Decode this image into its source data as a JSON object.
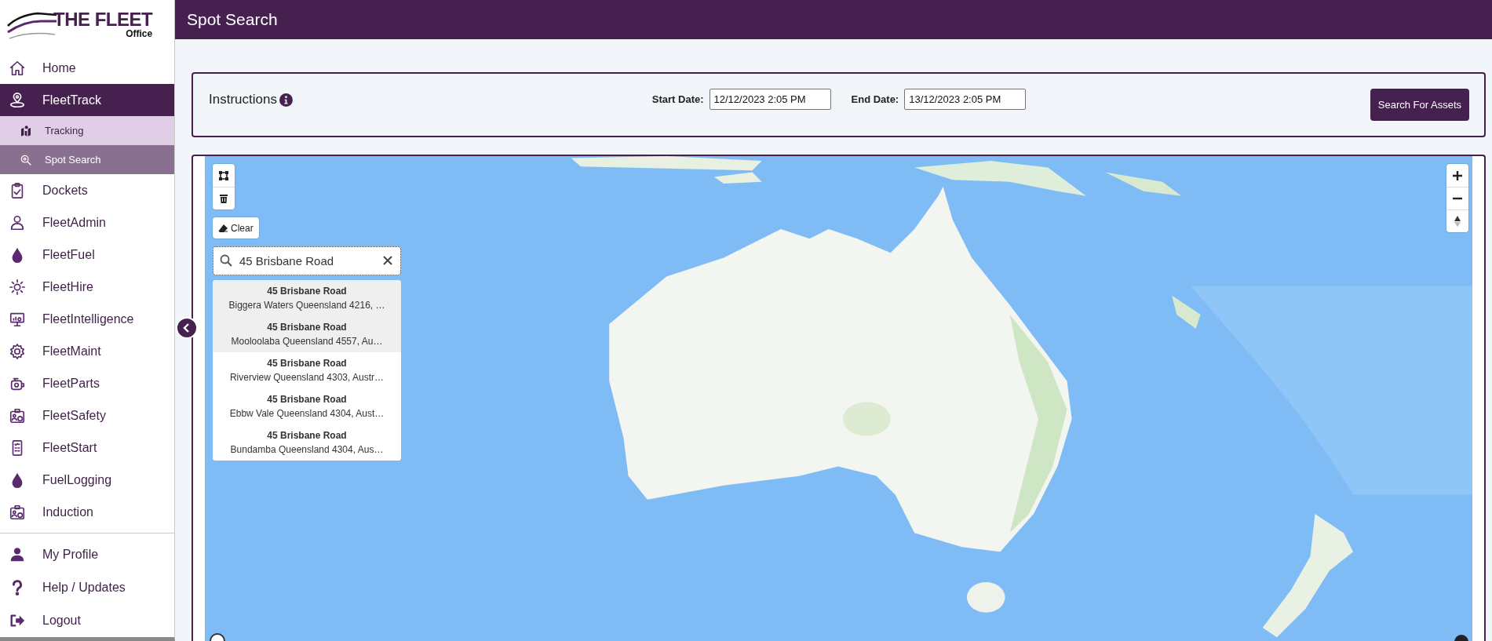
{
  "sidebar": {
    "logo": {
      "title": "THE FLEET",
      "subtitle": "Office"
    },
    "items": [
      {
        "label": "Home",
        "selected": false
      },
      {
        "label": "FleetTrack",
        "selected": true,
        "expanded": true,
        "children": [
          {
            "label": "Tracking",
            "selected": false
          },
          {
            "label": "Spot Search",
            "selected": true
          }
        ]
      },
      {
        "label": "Dockets",
        "selected": false
      },
      {
        "label": "FleetAdmin",
        "selected": false
      },
      {
        "label": "FleetFuel",
        "selected": false
      },
      {
        "label": "FleetHire",
        "selected": false
      },
      {
        "label": "FleetIntelligence",
        "selected": false
      },
      {
        "label": "FleetMaint",
        "selected": false
      },
      {
        "label": "FleetParts",
        "selected": false
      },
      {
        "label": "FleetSafety",
        "selected": false
      },
      {
        "label": "FleetStart",
        "selected": false
      },
      {
        "label": "FuelLogging",
        "selected": false
      },
      {
        "label": "Induction",
        "selected": false
      }
    ],
    "footer_items": [
      {
        "label": "My Profile"
      },
      {
        "label": "Help / Updates"
      },
      {
        "label": "Logout"
      }
    ]
  },
  "header": {
    "title": "Spot Search"
  },
  "filters": {
    "instructions": "Instructions",
    "start_date": {
      "label": "Start Date:",
      "value": "12/12/2023 2:05 PM"
    },
    "end_date": {
      "label": "End Date:",
      "value": "13/12/2023 2:05 PM"
    },
    "search_button": "Search For Assets"
  },
  "map": {
    "kind": "picture",
    "clear_button": "Clear",
    "search": {
      "value": "45 Brisbane Road"
    },
    "results": [
      {
        "title": "45 Brisbane Road",
        "address": "Biggera Waters Queensland 4216, …",
        "highlighted": true
      },
      {
        "title": "45 Brisbane Road",
        "address": "Mooloolaba Queensland 4557, Au…",
        "highlighted": true
      },
      {
        "title": "45 Brisbane Road",
        "address": "Riverview Queensland 4303, Austr…",
        "highlighted": false
      },
      {
        "title": "45 Brisbane Road",
        "address": "Ebbw Vale Queensland 4304, Aust…",
        "highlighted": false
      },
      {
        "title": "45 Brisbane Road",
        "address": "Bundamba Queensland 4304, Aus…",
        "highlighted": false
      }
    ]
  }
}
